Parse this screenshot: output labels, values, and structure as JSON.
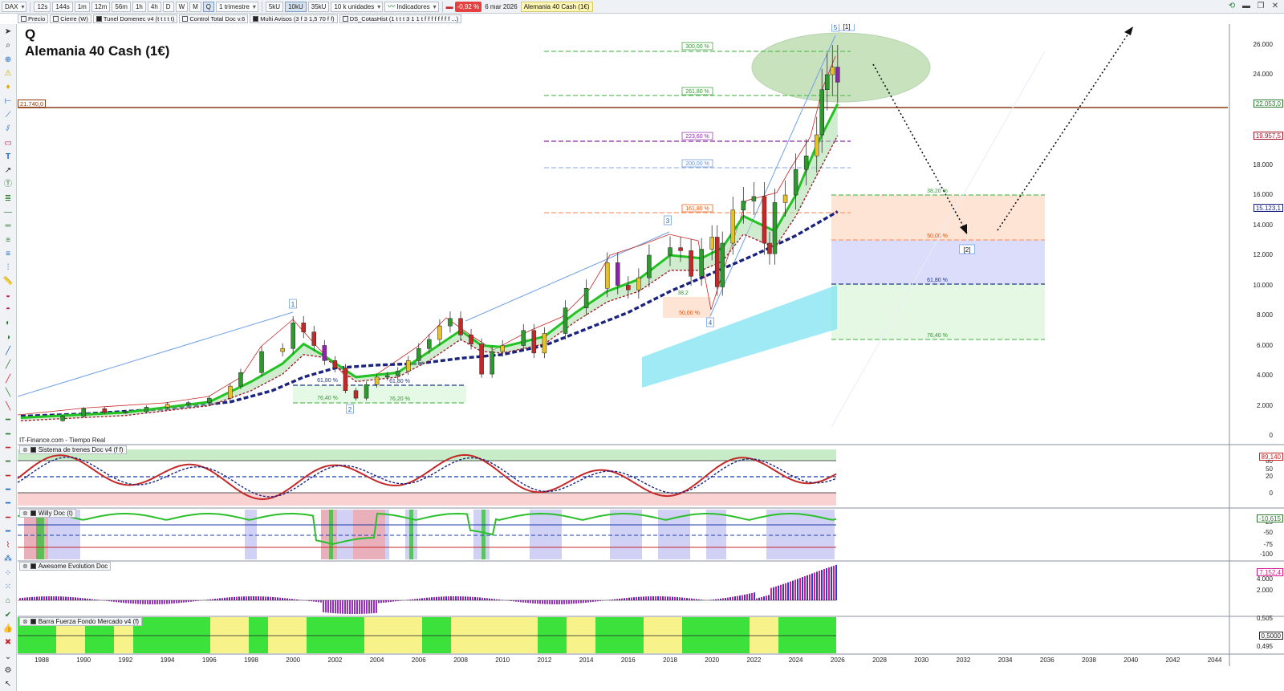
{
  "toolbar": {
    "symbol": "DAX",
    "intervals": [
      "12s",
      "144s",
      "1m",
      "12m",
      "56m",
      "1h",
      "4h",
      "D",
      "W",
      "M",
      "Q"
    ],
    "active_interval": "Q",
    "period": "1 trimestre",
    "units": [
      "5kU",
      "10kU",
      "35kU"
    ],
    "active_unit": "10kU",
    "units_select": "10 k unidades",
    "indicators_label": "Indicadores",
    "change_badge": "-0,92 %",
    "date": "6 mar 2026",
    "window_title": "Alemania 40 Cash (1€)"
  },
  "legend": {
    "items": [
      {
        "label": "Precio",
        "box": "light"
      },
      {
        "label": "Cierre (W)",
        "box": "light"
      },
      {
        "label": "Tunel Domenec v4 (t t t t t)",
        "box": "dark"
      },
      {
        "label": "Control Total Doc v.6",
        "box": "light"
      },
      {
        "label": "Multi Avisos (3 f 3 1,5 70 f f)",
        "box": "dark"
      },
      {
        "label": "DS_CotasHist (1 t t t 3 1 1 t f f f f f f f f ...)",
        "box": "light"
      }
    ]
  },
  "instrument": {
    "period_letter": "Q",
    "name": "Alemania 40 Cash (1€)"
  },
  "feed_label": "IT-Finance.com - Tiempo Real",
  "main_chart": {
    "y_ticks": [
      "26.000",
      "24.000",
      "22.000",
      "20.000",
      "18.000",
      "16.000",
      "14.000",
      "12.000",
      "10.000",
      "8.000",
      "6.000",
      "4.000",
      "2.000",
      "0"
    ],
    "left_level_tag": "21.740,0",
    "axis_tags": [
      {
        "text": "22.053,0",
        "color": "#2e7d32"
      },
      {
        "text": "19.957,5",
        "color": "#a0152b"
      },
      {
        "text": "15.123,1",
        "color": "#1a237e"
      }
    ],
    "fib_labels": [
      {
        "text": "300,00 %",
        "color": "#2e9a2e"
      },
      {
        "text": "261,80 %",
        "color": "#2e9a2e"
      },
      {
        "text": "223,60 %",
        "color": "#8e24aa"
      },
      {
        "text": "200,00 %",
        "color": "#5c8ed6"
      },
      {
        "text": "161,80 %",
        "color": "#e65100"
      },
      {
        "text": "38,20 %",
        "color": "#2e9a2e"
      },
      {
        "text": "50,00 %",
        "color": "#e65100"
      },
      {
        "text": "61,80 %",
        "color": "#1e3a8a"
      },
      {
        "text": "76,40 %",
        "color": "#2e9a2e"
      },
      {
        "text": "61,80 %",
        "color": "#1e3a8a"
      },
      {
        "text": "76,40 %",
        "color": "#2e9a2e"
      },
      {
        "text": "76,20 %",
        "color": "#2e9a2e"
      },
      {
        "text": "61,80 %",
        "color": "#1e3a8a"
      },
      {
        "text": "50,00 %",
        "color": "#e65100"
      },
      {
        "text": "38,2",
        "color": "#2e9a2e"
      }
    ],
    "wave_labels": [
      "1",
      "2",
      "3",
      "4",
      "5",
      "[1]",
      "[2]"
    ]
  },
  "panels": [
    {
      "title": "Sistema de trenes Doc v4 (f f)",
      "ticks": [
        "80",
        "50",
        "20",
        "0"
      ],
      "tag": "89,140"
    },
    {
      "title": "Willy Doc (t)",
      "ticks": [
        "-25",
        "-50",
        "-75",
        "-100"
      ],
      "tag": "-10,615"
    },
    {
      "title": "Awesome Evolution Doc",
      "ticks": [
        "4.000",
        "2.000"
      ],
      "tag": "7.152,4"
    },
    {
      "title": "Barra Fuerza Fondo Mercado v4 (f)",
      "ticks": [
        "0,505",
        "0,495"
      ],
      "tag": "0,5000"
    }
  ],
  "x_ticks": [
    "1988",
    "1990",
    "1992",
    "1994",
    "1996",
    "1998",
    "2000",
    "2002",
    "2004",
    "2006",
    "2008",
    "2010",
    "2012",
    "2014",
    "2016",
    "2018",
    "2020",
    "2022",
    "2024",
    "2026",
    "2028",
    "2030",
    "2032",
    "2034",
    "2036",
    "2038",
    "2040",
    "2042",
    "2044"
  ],
  "chart_data": {
    "type": "candlestick",
    "title": "Alemania 40 Cash (1€)",
    "period": "Q",
    "x_unit": "year",
    "ylim": [
      0,
      27000
    ],
    "quarterly_close": [
      {
        "x": 1988.0,
        "y": 1000
      },
      {
        "x": 1989.0,
        "y": 1300
      },
      {
        "x": 1990.0,
        "y": 1800
      },
      {
        "x": 1991.0,
        "y": 1550
      },
      {
        "x": 1992.0,
        "y": 1600
      },
      {
        "x": 1993.0,
        "y": 1900
      },
      {
        "x": 1994.0,
        "y": 2100
      },
      {
        "x": 1995.0,
        "y": 2200
      },
      {
        "x": 1996.0,
        "y": 2500
      },
      {
        "x": 1997.0,
        "y": 3300
      },
      {
        "x": 1997.5,
        "y": 4200
      },
      {
        "x": 1998.5,
        "y": 5600
      },
      {
        "x": 1999.5,
        "y": 5800
      },
      {
        "x": 2000.0,
        "y": 7500
      },
      {
        "x": 2000.5,
        "y": 6900
      },
      {
        "x": 2001.0,
        "y": 6000
      },
      {
        "x": 2001.5,
        "y": 5000
      },
      {
        "x": 2002.0,
        "y": 4500
      },
      {
        "x": 2002.5,
        "y": 3000
      },
      {
        "x": 2003.0,
        "y": 2500
      },
      {
        "x": 2003.5,
        "y": 3400
      },
      {
        "x": 2004.0,
        "y": 3900
      },
      {
        "x": 2004.5,
        "y": 4000
      },
      {
        "x": 2005.0,
        "y": 4300
      },
      {
        "x": 2005.5,
        "y": 5000
      },
      {
        "x": 2006.0,
        "y": 5800
      },
      {
        "x": 2006.5,
        "y": 6400
      },
      {
        "x": 2007.0,
        "y": 7300
      },
      {
        "x": 2007.5,
        "y": 7800
      },
      {
        "x": 2008.0,
        "y": 6700
      },
      {
        "x": 2008.5,
        "y": 6100
      },
      {
        "x": 2009.0,
        "y": 4100
      },
      {
        "x": 2009.5,
        "y": 5600
      },
      {
        "x": 2010.0,
        "y": 6000
      },
      {
        "x": 2011.0,
        "y": 7000
      },
      {
        "x": 2011.5,
        "y": 5500
      },
      {
        "x": 2012.0,
        "y": 6800
      },
      {
        "x": 2013.0,
        "y": 8500
      },
      {
        "x": 2014.0,
        "y": 9800
      },
      {
        "x": 2015.0,
        "y": 11500
      },
      {
        "x": 2015.5,
        "y": 10000
      },
      {
        "x": 2016.0,
        "y": 9700
      },
      {
        "x": 2016.5,
        "y": 10500
      },
      {
        "x": 2017.0,
        "y": 12000
      },
      {
        "x": 2018.0,
        "y": 12500
      },
      {
        "x": 2018.5,
        "y": 12300
      },
      {
        "x": 2019.0,
        "y": 10600
      },
      {
        "x": 2019.5,
        "y": 12400
      },
      {
        "x": 2020.0,
        "y": 13200
      },
      {
        "x": 2020.25,
        "y": 9900
      },
      {
        "x": 2020.5,
        "y": 12800
      },
      {
        "x": 2021.0,
        "y": 15000
      },
      {
        "x": 2021.5,
        "y": 15600
      },
      {
        "x": 2022.0,
        "y": 15900
      },
      {
        "x": 2022.5,
        "y": 12800
      },
      {
        "x": 2022.75,
        "y": 12100
      },
      {
        "x": 2023.0,
        "y": 15500
      },
      {
        "x": 2023.5,
        "y": 16000
      },
      {
        "x": 2024.0,
        "y": 17700
      },
      {
        "x": 2024.5,
        "y": 18600
      },
      {
        "x": 2025.0,
        "y": 20000
      },
      {
        "x": 2025.25,
        "y": 23000
      },
      {
        "x": 2025.5,
        "y": 24000
      },
      {
        "x": 2025.75,
        "y": 24500
      },
      {
        "x": 2026.0,
        "y": 23500
      }
    ],
    "levels": {
      "horizontal_line": 21740,
      "price_axis_tags": [
        22053.0,
        19957.5,
        15123.1
      ]
    }
  }
}
